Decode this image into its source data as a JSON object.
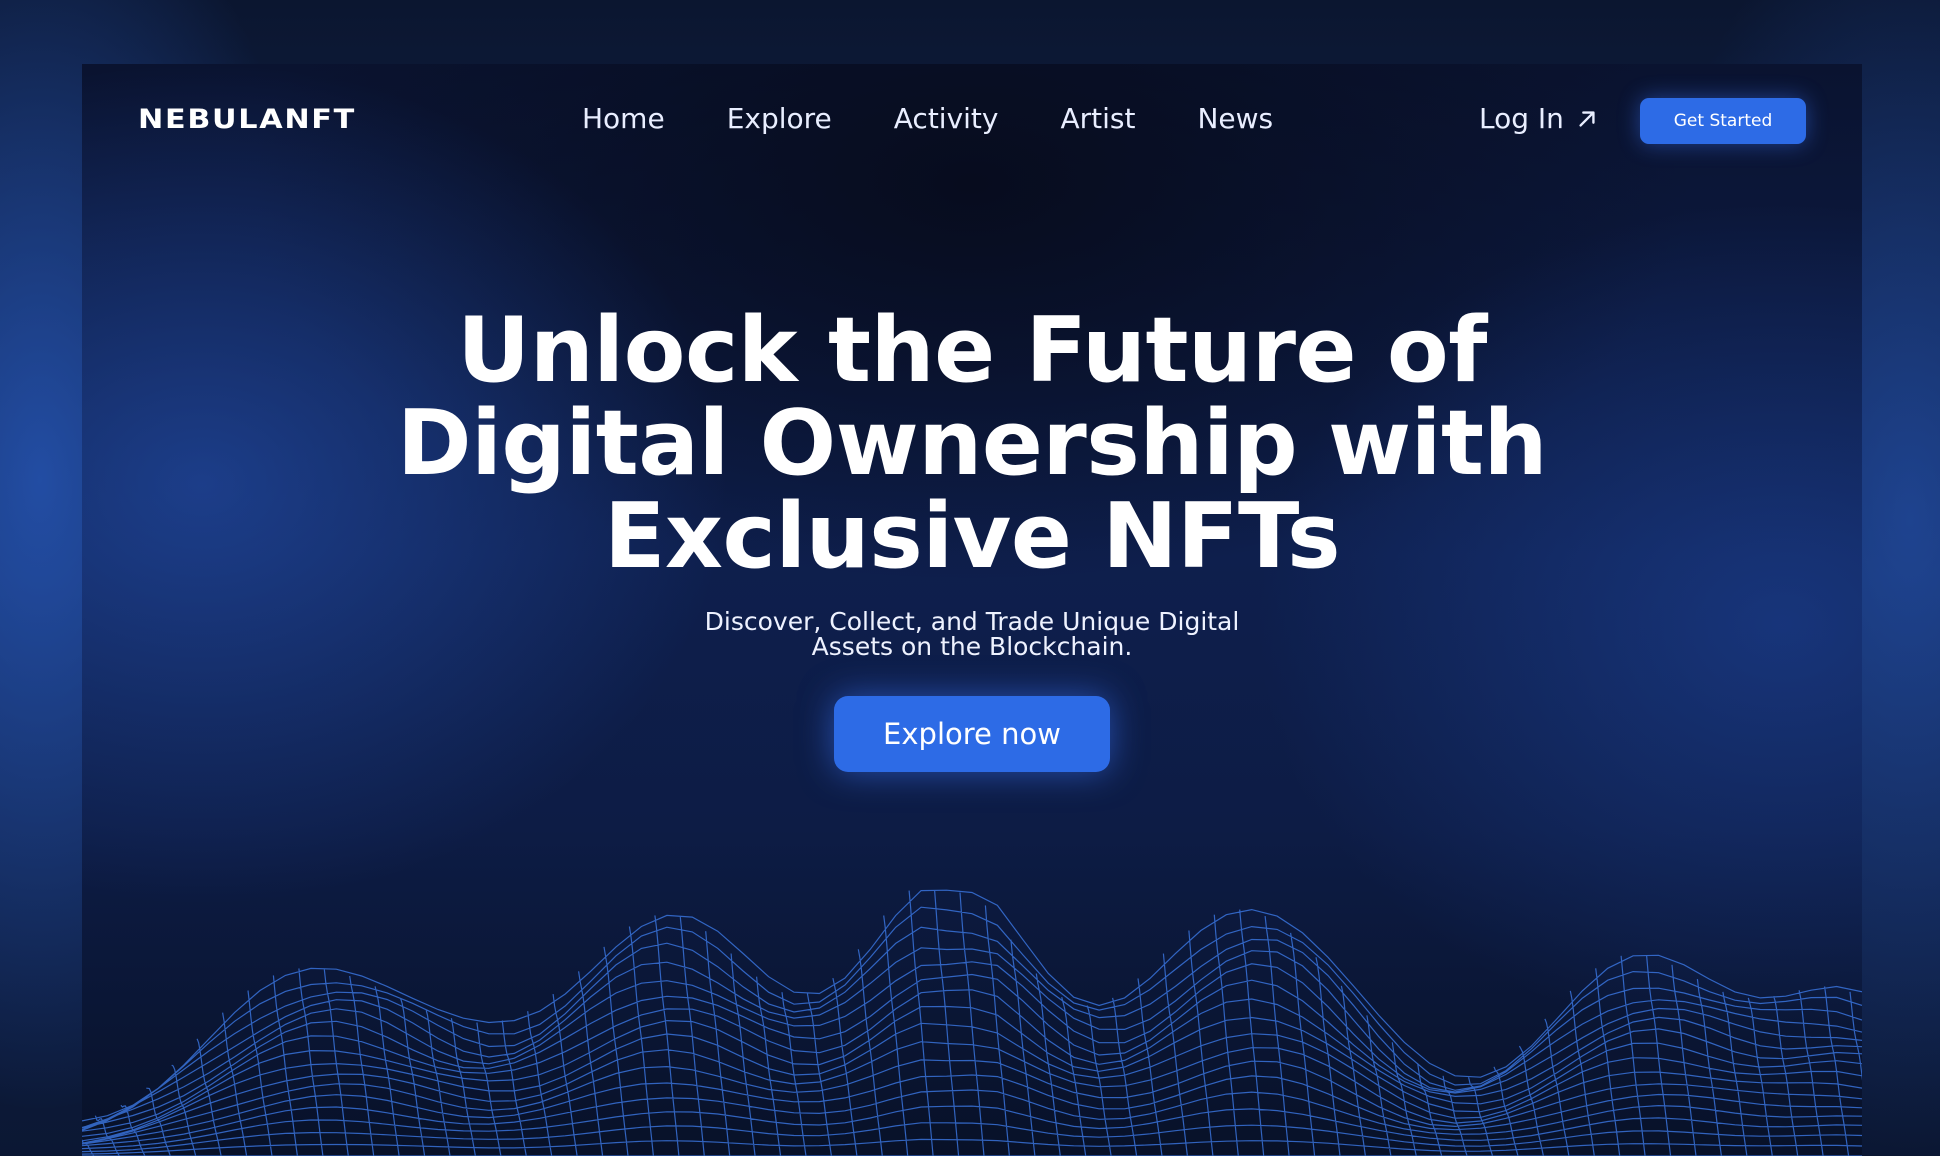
{
  "brand": {
    "logo": "NEBULANFT"
  },
  "nav": {
    "items": [
      {
        "label": "Home"
      },
      {
        "label": "Explore"
      },
      {
        "label": "Activity"
      },
      {
        "label": "Artist"
      },
      {
        "label": "News"
      }
    ],
    "login_label": "Log In",
    "login_icon": "arrow-up-right-icon",
    "cta_label": "Get Started"
  },
  "hero": {
    "headline_lines": [
      "Unlock the Future of",
      "Digital Ownership with",
      "Exclusive NFTs"
    ],
    "subtitle_lines": [
      "Discover, Collect, and Trade Unique Digital",
      "Assets on the Blockchain."
    ],
    "cta_label": "Explore now"
  },
  "colors": {
    "accent": "#2d6be6",
    "background": "#0a1330",
    "mesh": "#3f7ff0"
  }
}
